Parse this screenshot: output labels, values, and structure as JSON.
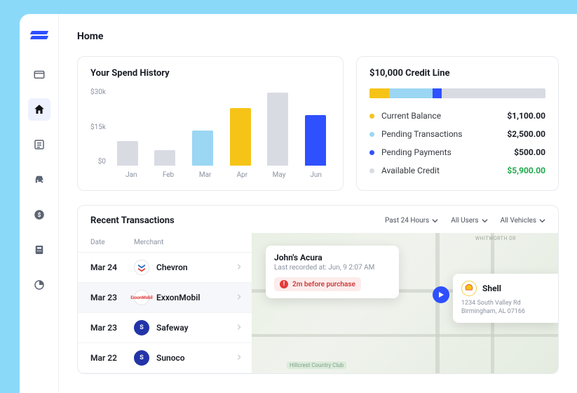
{
  "page_title": "Home",
  "spend_card_title": "Your Spend History",
  "credit_card_title": "$10,000 Credit Line",
  "credit_items": [
    {
      "label": "Current Balance",
      "value": "$1,100.00",
      "color": "#f6c417"
    },
    {
      "label": "Pending Transactions",
      "value": "$2,500.00",
      "color": "#9bd6f3"
    },
    {
      "label": "Pending Payments",
      "value": "$500.00",
      "color": "#2f50ff"
    },
    {
      "label": "Available Credit",
      "value": "$5,900.00",
      "color": "#d8dbe2",
      "green": true
    }
  ],
  "transactions_title": "Recent Transactions",
  "filters": {
    "time": "Past 24 Hours",
    "users": "All Users",
    "vehicles": "All Vehicles"
  },
  "trans_cols": {
    "date": "Date",
    "merchant": "Merchant"
  },
  "transactions": [
    {
      "date": "Mar 24",
      "merchant": "Chevron"
    },
    {
      "date": "Mar 23",
      "merchant": "ExxonMobil"
    },
    {
      "date": "Mar 23",
      "merchant": "Safeway"
    },
    {
      "date": "Mar 22",
      "merchant": "Sunoco"
    }
  ],
  "vehicle_popup": {
    "title": "John's Acura",
    "subtitle": "Last recorded at: Jun, 9 2:07 AM",
    "warn": "2m before purchase"
  },
  "station_popup": {
    "name": "Shell",
    "addr1": "1234 South Valley Rd",
    "addr2": "Birmingham, AL 07166"
  },
  "map_labels": {
    "whitworth": "WHITWORTH DR",
    "country": "Hillcrest Country Club"
  },
  "chart_data": {
    "type": "bar",
    "title": "Your Spend History",
    "xlabel": "",
    "ylabel": "",
    "ylim": [
      0,
      35
    ],
    "yticks": [
      "$30k",
      "$15k",
      "$0"
    ],
    "categories": [
      "Jan",
      "Feb",
      "Mar",
      "Apr",
      "May",
      "Jun"
    ],
    "values": [
      11,
      7,
      16,
      26,
      33,
      23
    ],
    "colors": [
      "#d8dbe2",
      "#d8dbe2",
      "#9bd6f3",
      "#f6c417",
      "#d8dbe2",
      "#2f50ff"
    ]
  }
}
